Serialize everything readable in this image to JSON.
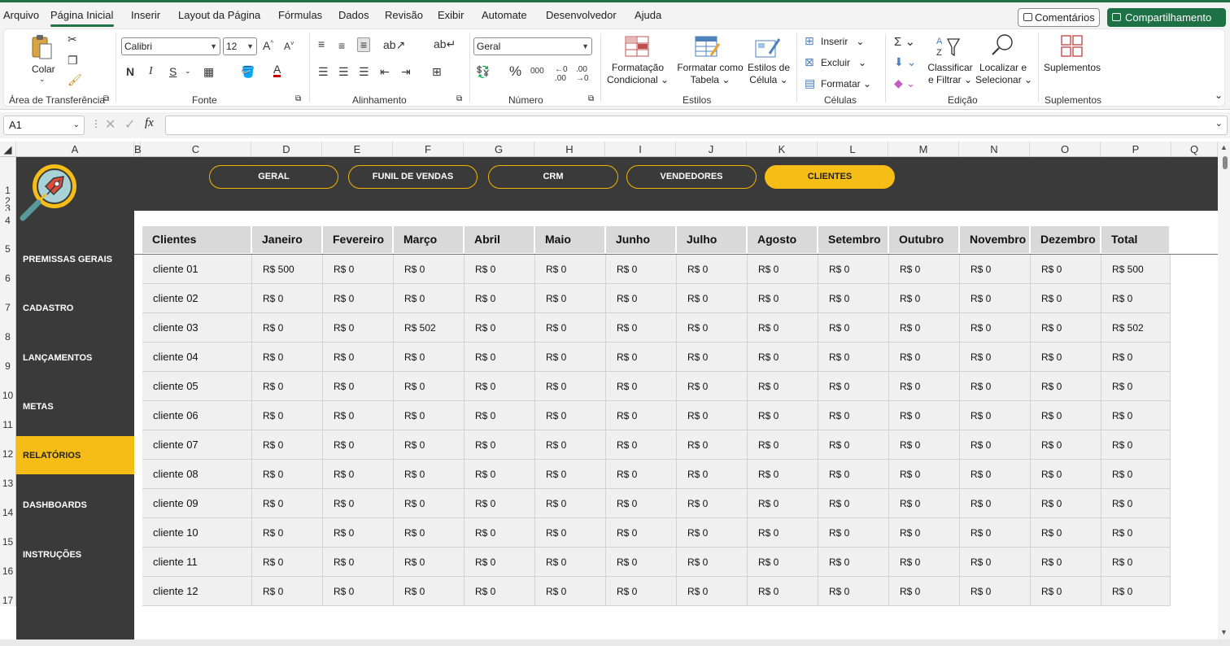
{
  "menu": {
    "items": [
      "Arquivo",
      "Página Inicial",
      "Inserir",
      "Layout da Página",
      "Fórmulas",
      "Dados",
      "Revisão",
      "Exibir",
      "Automate",
      "Desenvolvedor",
      "Ajuda"
    ],
    "comments_label": "Comentários",
    "share_label": "Compartilhamento"
  },
  "ribbon": {
    "paste_label": "Colar",
    "font_name": "Calibri",
    "font_size": "12",
    "number_format": "Geral",
    "bold": "N",
    "italic": "I",
    "underline": "S",
    "cond_format": [
      "Formatação",
      "Condicional"
    ],
    "format_table": [
      "Formatar como",
      "Tabela"
    ],
    "cell_styles": [
      "Estilos de",
      "Célula"
    ],
    "insert": "Inserir",
    "delete": "Excluir",
    "format": "Formatar",
    "sort_filter": [
      "Classificar",
      "e Filtrar"
    ],
    "find_select": [
      "Localizar e",
      "Selecionar"
    ],
    "addins": "Suplementos",
    "groups": [
      "Área de Transferência",
      "Fonte",
      "Alinhamento",
      "Número",
      "Estilos",
      "Células",
      "Edição",
      "Suplementos"
    ]
  },
  "formula_bar": {
    "name_box": "A1",
    "fx": "fx",
    "value": ""
  },
  "columns": [
    "A",
    "B",
    "C",
    "D",
    "E",
    "F",
    "G",
    "H",
    "I",
    "J",
    "K",
    "L",
    "M",
    "N",
    "O",
    "P",
    "Q"
  ],
  "rows": [
    "1",
    "2",
    "3",
    "4",
    "5",
    "6",
    "7",
    "8",
    "9",
    "10",
    "11",
    "12",
    "13",
    "14",
    "15",
    "16",
    "17"
  ],
  "nav_tabs": [
    {
      "label": "GERAL",
      "active": false
    },
    {
      "label": "FUNIL DE VENDAS",
      "active": false
    },
    {
      "label": "CRM",
      "active": false
    },
    {
      "label": "VENDEDORES",
      "active": false
    },
    {
      "label": "CLIENTES",
      "active": true
    }
  ],
  "sidebar": [
    {
      "label": "PREMISSAS GERAIS",
      "active": false
    },
    {
      "label": "CADASTRO",
      "active": false
    },
    {
      "label": "LANÇAMENTOS",
      "active": false
    },
    {
      "label": "METAS",
      "active": false
    },
    {
      "label": "RELATÓRIOS",
      "active": true
    },
    {
      "label": "DASHBOARDS",
      "active": false
    },
    {
      "label": "INSTRUÇÕES",
      "active": false
    }
  ],
  "colors": {
    "accent": "#f6bd16",
    "dark": "#3a3a3a",
    "excel_green": "#217346"
  },
  "table": {
    "headers": [
      "Clientes",
      "Janeiro",
      "Fevereiro",
      "Março",
      "Abril",
      "Maio",
      "Junho",
      "Julho",
      "Agosto",
      "Setembro",
      "Outubro",
      "Novembro",
      "Dezembro",
      "Total"
    ],
    "rows": [
      [
        "cliente 01",
        "R$ 500",
        "R$ 0",
        "R$ 0",
        "R$ 0",
        "R$ 0",
        "R$ 0",
        "R$ 0",
        "R$ 0",
        "R$ 0",
        "R$ 0",
        "R$ 0",
        "R$ 0",
        "R$ 500"
      ],
      [
        "cliente 02",
        "R$ 0",
        "R$ 0",
        "R$ 0",
        "R$ 0",
        "R$ 0",
        "R$ 0",
        "R$ 0",
        "R$ 0",
        "R$ 0",
        "R$ 0",
        "R$ 0",
        "R$ 0",
        "R$ 0"
      ],
      [
        "cliente 03",
        "R$ 0",
        "R$ 0",
        "R$ 502",
        "R$ 0",
        "R$ 0",
        "R$ 0",
        "R$ 0",
        "R$ 0",
        "R$ 0",
        "R$ 0",
        "R$ 0",
        "R$ 0",
        "R$ 502"
      ],
      [
        "cliente 04",
        "R$ 0",
        "R$ 0",
        "R$ 0",
        "R$ 0",
        "R$ 0",
        "R$ 0",
        "R$ 0",
        "R$ 0",
        "R$ 0",
        "R$ 0",
        "R$ 0",
        "R$ 0",
        "R$ 0"
      ],
      [
        "cliente 05",
        "R$ 0",
        "R$ 0",
        "R$ 0",
        "R$ 0",
        "R$ 0",
        "R$ 0",
        "R$ 0",
        "R$ 0",
        "R$ 0",
        "R$ 0",
        "R$ 0",
        "R$ 0",
        "R$ 0"
      ],
      [
        "cliente 06",
        "R$ 0",
        "R$ 0",
        "R$ 0",
        "R$ 0",
        "R$ 0",
        "R$ 0",
        "R$ 0",
        "R$ 0",
        "R$ 0",
        "R$ 0",
        "R$ 0",
        "R$ 0",
        "R$ 0"
      ],
      [
        "cliente 07",
        "R$ 0",
        "R$ 0",
        "R$ 0",
        "R$ 0",
        "R$ 0",
        "R$ 0",
        "R$ 0",
        "R$ 0",
        "R$ 0",
        "R$ 0",
        "R$ 0",
        "R$ 0",
        "R$ 0"
      ],
      [
        "cliente 08",
        "R$ 0",
        "R$ 0",
        "R$ 0",
        "R$ 0",
        "R$ 0",
        "R$ 0",
        "R$ 0",
        "R$ 0",
        "R$ 0",
        "R$ 0",
        "R$ 0",
        "R$ 0",
        "R$ 0"
      ],
      [
        "cliente 09",
        "R$ 0",
        "R$ 0",
        "R$ 0",
        "R$ 0",
        "R$ 0",
        "R$ 0",
        "R$ 0",
        "R$ 0",
        "R$ 0",
        "R$ 0",
        "R$ 0",
        "R$ 0",
        "R$ 0"
      ],
      [
        "cliente 10",
        "R$ 0",
        "R$ 0",
        "R$ 0",
        "R$ 0",
        "R$ 0",
        "R$ 0",
        "R$ 0",
        "R$ 0",
        "R$ 0",
        "R$ 0",
        "R$ 0",
        "R$ 0",
        "R$ 0"
      ],
      [
        "cliente 11",
        "R$ 0",
        "R$ 0",
        "R$ 0",
        "R$ 0",
        "R$ 0",
        "R$ 0",
        "R$ 0",
        "R$ 0",
        "R$ 0",
        "R$ 0",
        "R$ 0",
        "R$ 0",
        "R$ 0"
      ],
      [
        "cliente 12",
        "R$ 0",
        "R$ 0",
        "R$ 0",
        "R$ 0",
        "R$ 0",
        "R$ 0",
        "R$ 0",
        "R$ 0",
        "R$ 0",
        "R$ 0",
        "R$ 0",
        "R$ 0",
        "R$ 0"
      ]
    ]
  }
}
